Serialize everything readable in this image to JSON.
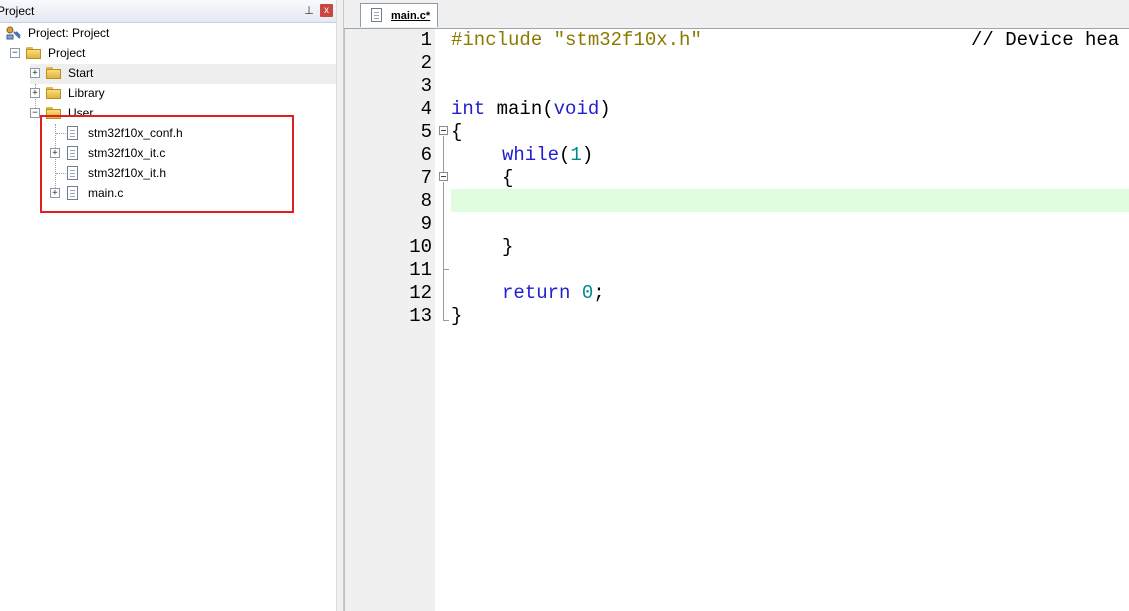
{
  "panel": {
    "title": "Project",
    "pin_glyph": "⊥",
    "close_glyph": "x"
  },
  "tree": {
    "root_label": "Project: Project",
    "project_label": "Project",
    "folders": [
      "Start",
      "Library",
      "User"
    ],
    "user_files": [
      "stm32f10x_conf.h",
      "stm32f10x_it.c",
      "stm32f10x_it.h",
      "main.c"
    ]
  },
  "editor": {
    "tab_label": "main.c*",
    "line_numbers": [
      "1",
      "2",
      "3",
      "4",
      "5",
      "6",
      "7",
      "8",
      "9",
      "10",
      "11",
      "12",
      "13"
    ],
    "code": {
      "l1_directive": "#include",
      "l1_string": "\"stm32f10x.h\"",
      "l1_comment": "// Device hea",
      "l4_type": "int",
      "l4_name": " main(",
      "l4_param": "void",
      "l4_close": ")",
      "l5": "{",
      "l6_kw": "while",
      "l6_open": "(",
      "l6_num": "1",
      "l6_close": ")",
      "l7": "{",
      "l10": "}",
      "l12_kw": "return",
      "l12_num": "0",
      "l12_end": ";",
      "l13": "}"
    }
  }
}
